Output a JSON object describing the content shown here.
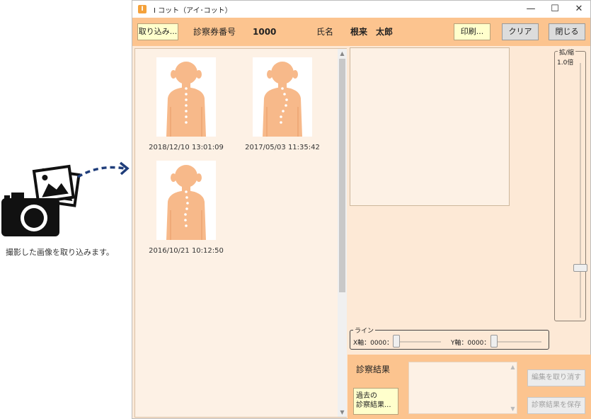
{
  "illustration": {
    "caption": "撮影した画像を取り込みます。",
    "icon": "camera-photos-icon"
  },
  "window": {
    "title": "I コット（アイ･コット）",
    "controls": {
      "minimize": "—",
      "maximize": "☐",
      "close": "✕"
    }
  },
  "toolbar": {
    "import_label": "取り込み...",
    "card_no_label": "診察券番号",
    "card_no_value": "1000",
    "name_label": "氏名",
    "name_value": "根来　太郎",
    "print_label": "印刷...",
    "clear_label": "クリア",
    "close_label": "閉じる"
  },
  "thumbnails": [
    {
      "timestamp": "2018/12/10 13:01:09",
      "spine": "straight"
    },
    {
      "timestamp": "2017/05/03 11:35:42",
      "spine": "curved"
    },
    {
      "timestamp": "2016/10/21 10:12:50",
      "spine": "slight"
    }
  ],
  "zoom": {
    "title": "拡/縮",
    "value": "1.0倍"
  },
  "line": {
    "title": "ライン",
    "x_label": "X軸：0000：",
    "y_label": "Y軸：0000："
  },
  "result": {
    "label": "診察結果",
    "past_button": [
      "過去の",
      "診察結果..."
    ],
    "cancel_edit_label": "編集を取り消す",
    "save_label": "診察結果を保存"
  },
  "colors": {
    "toolbar": "#fcc48f",
    "panel": "#fde9d6",
    "body_figure": "#f7b98a"
  }
}
